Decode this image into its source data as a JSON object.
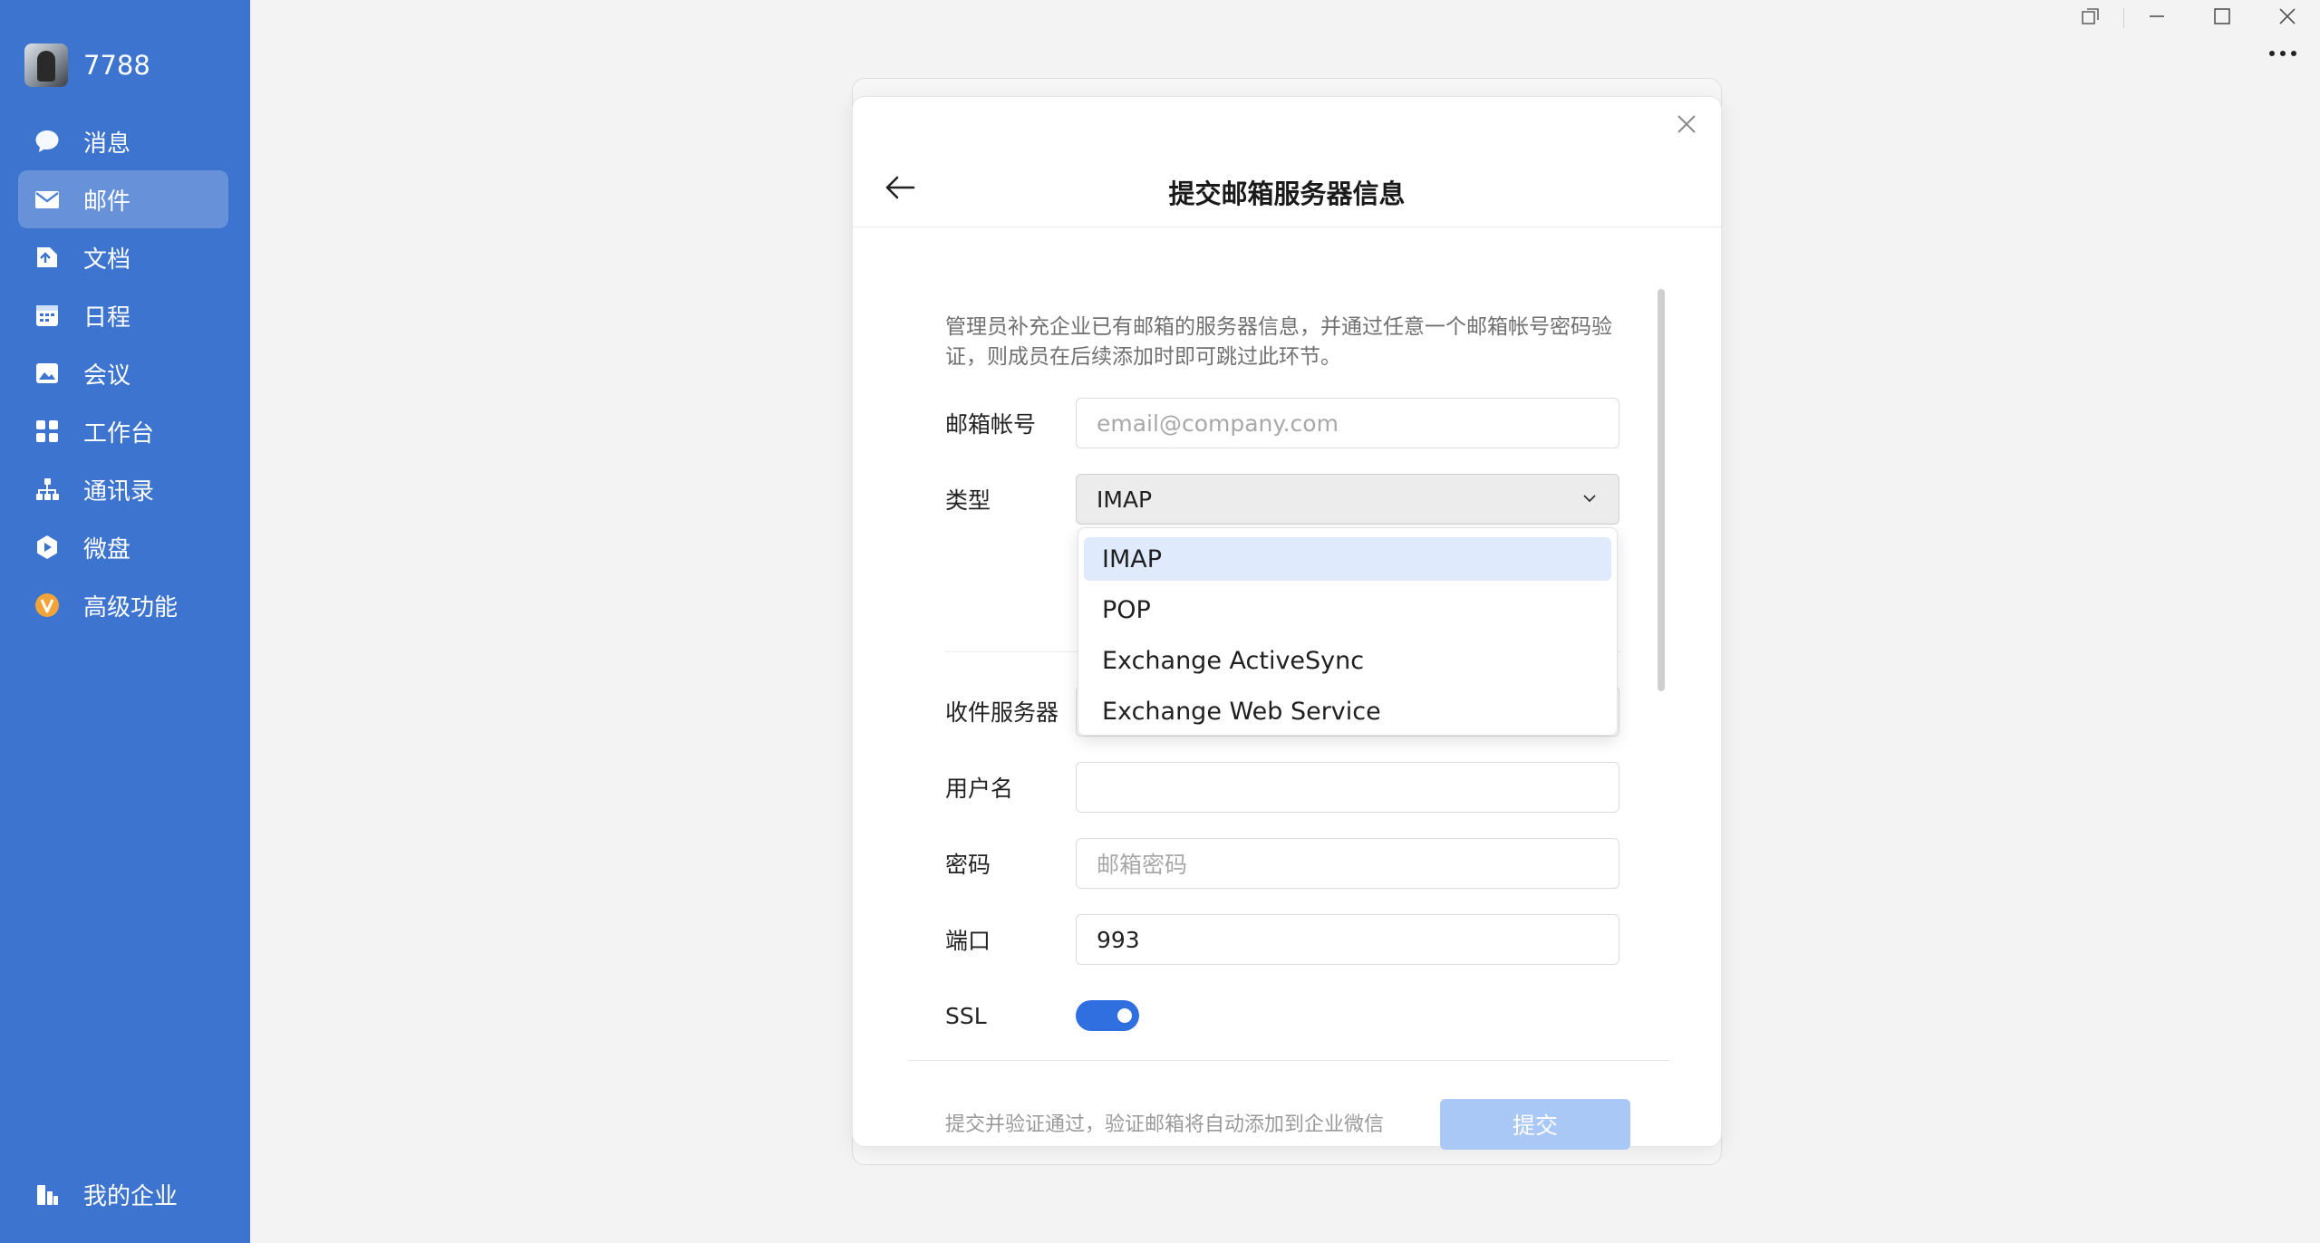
{
  "profile": {
    "name": "7788"
  },
  "nav": {
    "items": [
      {
        "label": "消息",
        "icon": "chat-icon"
      },
      {
        "label": "邮件",
        "icon": "mail-icon",
        "active": true
      },
      {
        "label": "文档",
        "icon": "document-icon"
      },
      {
        "label": "日程",
        "icon": "calendar-icon"
      },
      {
        "label": "会议",
        "icon": "meeting-icon"
      },
      {
        "label": "工作台",
        "icon": "workbench-icon"
      },
      {
        "label": "通讯录",
        "icon": "contacts-icon"
      },
      {
        "label": "微盘",
        "icon": "drive-icon"
      },
      {
        "label": "高级功能",
        "icon": "premium-icon"
      }
    ],
    "bottom": {
      "label": "我的企业",
      "icon": "enterprise-icon"
    }
  },
  "modal": {
    "title": "提交邮箱服务器信息",
    "description": "管理员补充企业已有邮箱的服务器信息，并通过任意一个邮箱帐号密码验证，则成员在后续添加时即可跳过此环节。",
    "fields": {
      "email": {
        "label": "邮箱帐号",
        "placeholder": "email@company.com"
      },
      "type": {
        "label": "类型",
        "value": "IMAP"
      },
      "incoming_server": {
        "label": "收件服务器"
      },
      "username": {
        "label": "用户名"
      },
      "password": {
        "label": "密码",
        "placeholder": "邮箱密码"
      },
      "port": {
        "label": "端口",
        "value": "993"
      },
      "ssl": {
        "label": "SSL",
        "enabled": true
      }
    },
    "footer_hint": "提交并验证通过，验证邮箱将自动添加到企业微信",
    "submit_label": "提交"
  },
  "dropdown": {
    "options": [
      "IMAP",
      "POP",
      "Exchange ActiveSync",
      "Exchange Web Service"
    ],
    "selected": "IMAP"
  },
  "colors": {
    "sidebar": "#3d74cf",
    "accent": "#2f6fe0",
    "submit_disabled": "#a9c8f5",
    "dropdown_selected": "#dfeafc"
  }
}
